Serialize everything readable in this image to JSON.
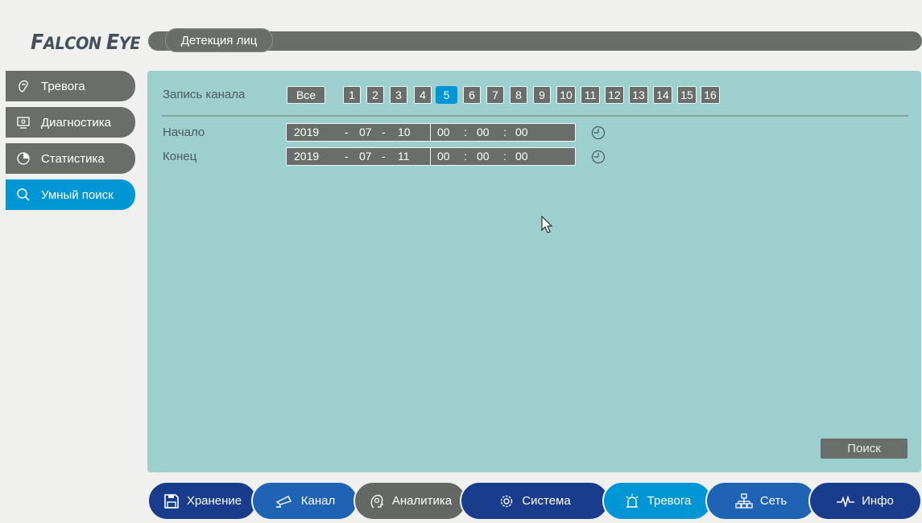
{
  "logo": {
    "first_initial": "F",
    "first_rest": "ALCON",
    "second_initial": "E",
    "second_rest": "YE"
  },
  "top_tab": "Детекция лиц",
  "sidebar": [
    {
      "label": "Тревога",
      "icon": "sound-icon",
      "active": false
    },
    {
      "label": "Диагностика",
      "icon": "diagnostics-icon",
      "active": false
    },
    {
      "label": "Статистика",
      "icon": "pie-chart-icon",
      "active": false
    },
    {
      "label": "Умный поиск",
      "icon": "search-icon",
      "active": true
    }
  ],
  "channel_record_label": "Запись канала",
  "channels": {
    "all_label": "Все",
    "items": [
      "1",
      "2",
      "3",
      "4",
      "5",
      "6",
      "7",
      "8",
      "9",
      "10",
      "11",
      "12",
      "13",
      "14",
      "15",
      "16"
    ],
    "selected": "5"
  },
  "start": {
    "label": "Начало",
    "year": "2019",
    "month": "07",
    "day": "10",
    "hour": "00",
    "minute": "00",
    "second": "00"
  },
  "end": {
    "label": "Конец",
    "year": "2019",
    "month": "07",
    "day": "11",
    "hour": "00",
    "minute": "00",
    "second": "00"
  },
  "search_button": "Поиск",
  "bottom_nav": [
    {
      "label": "Хранение",
      "icon": "save-icon"
    },
    {
      "label": "Канал",
      "icon": "camera-icon"
    },
    {
      "label": "Аналитика",
      "icon": "head-icon"
    },
    {
      "label": "Система",
      "icon": "gear-icon"
    },
    {
      "label": "Тревога",
      "icon": "alarm-icon"
    },
    {
      "label": "Сеть",
      "icon": "network-icon"
    },
    {
      "label": "Инфо",
      "icon": "pulse-icon"
    }
  ],
  "colors": {
    "accent": "#0096d6",
    "panel": "#9ccfcd",
    "button": "#6a6e6a",
    "nav_dark": "#1a3c8c",
    "nav_mid": "#1f64b4"
  }
}
